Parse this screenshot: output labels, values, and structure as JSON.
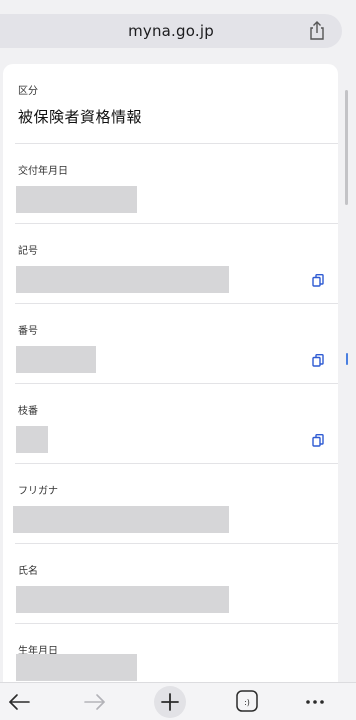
{
  "browser": {
    "url": "myna.go.jp"
  },
  "fields": [
    {
      "label": "区分",
      "value": "被保険者資格情報",
      "copyable": false
    },
    {
      "label": "交付年月日",
      "value": "",
      "copyable": false
    },
    {
      "label": "記号",
      "value": "",
      "copyable": true
    },
    {
      "label": "番号",
      "value": "",
      "copyable": true
    },
    {
      "label": "枝番",
      "value": "",
      "copyable": true
    },
    {
      "label": "フリガナ",
      "value": "",
      "copyable": false
    },
    {
      "label": "氏名",
      "value": "",
      "copyable": false
    },
    {
      "label": "生年月日",
      "value": "",
      "copyable": false
    }
  ],
  "icons": {
    "share": "share-icon",
    "copy": "copy-icon",
    "back": "back-arrow-icon",
    "forward": "forward-arrow-icon",
    "new_tab": "plus-icon",
    "tabs": "tabs-icon",
    "more": "more-dots-icon"
  },
  "toolbar": {
    "tabs_glyph": ":)"
  },
  "colors": {
    "accent": "#2f5bd3",
    "redaction": "#d6d6d8"
  }
}
